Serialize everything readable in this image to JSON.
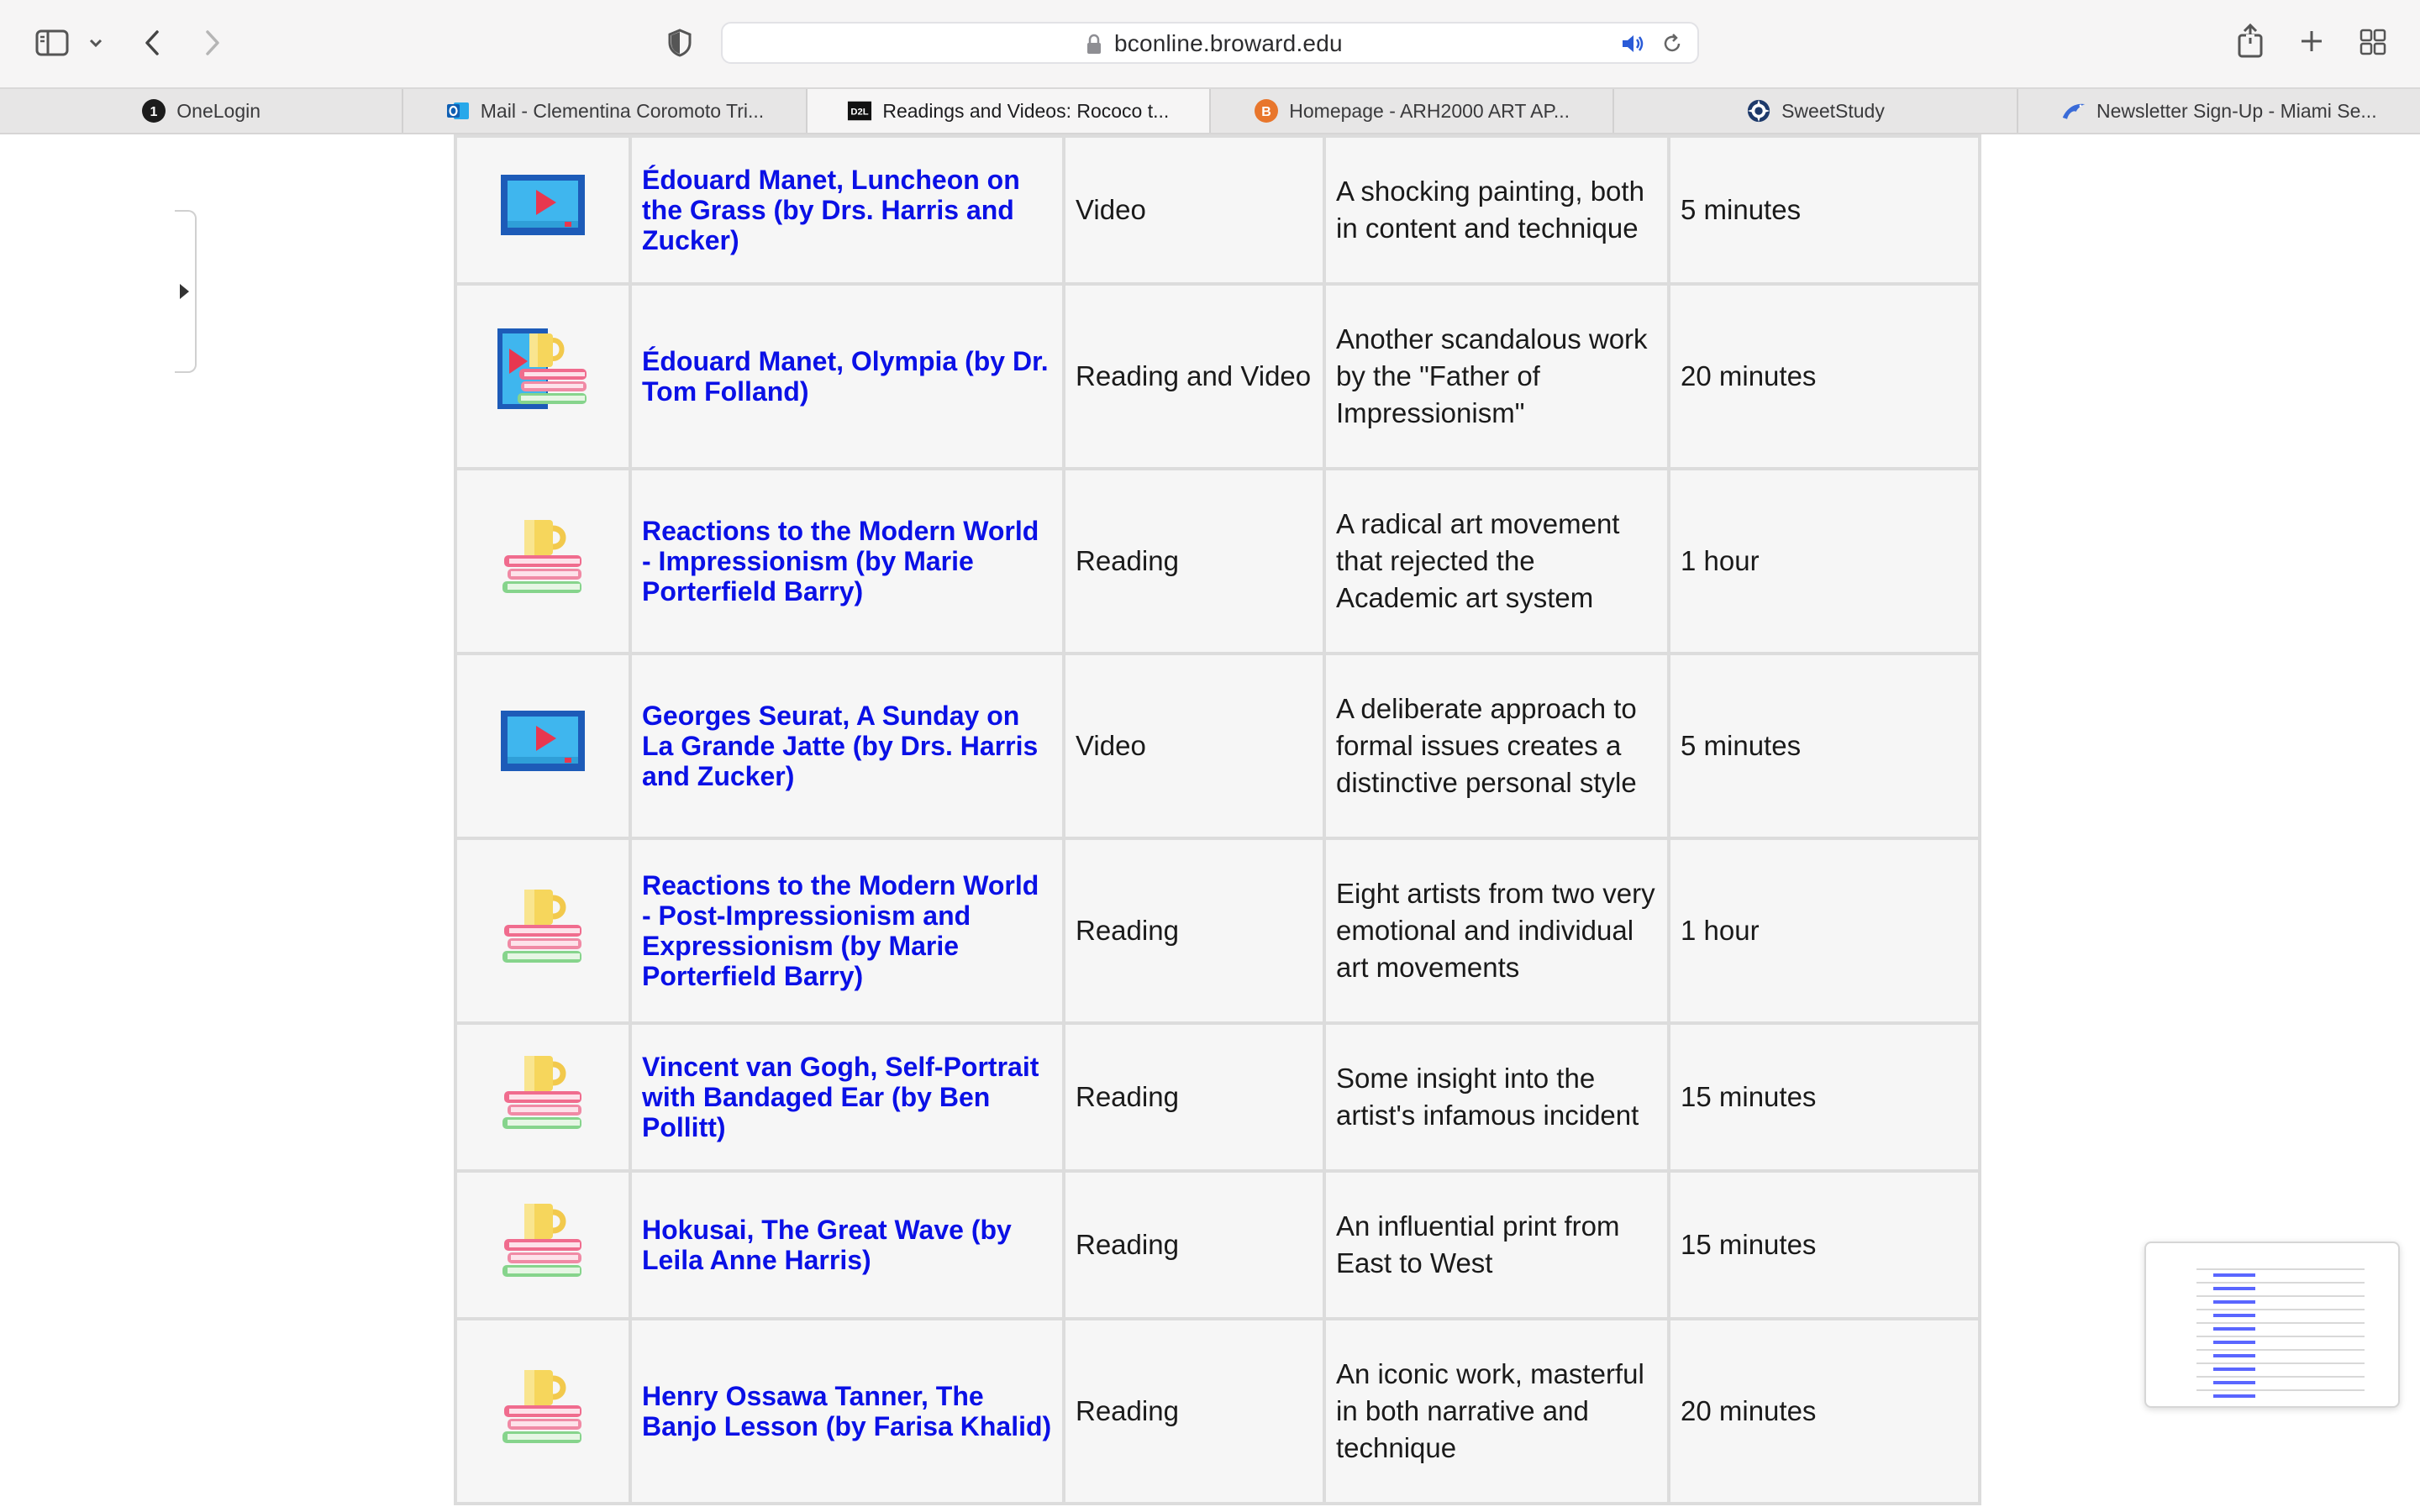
{
  "browser": {
    "url": "bconline.broward.edu"
  },
  "tabs": [
    {
      "label": "OneLogin",
      "icon": "onelogin-icon",
      "active": false
    },
    {
      "label": "Mail - Clementina Coromoto Tri...",
      "icon": "outlook-icon",
      "active": false
    },
    {
      "label": "Readings and Videos: Rococo t...",
      "icon": "d2l-icon",
      "active": true
    },
    {
      "label": "Homepage - ARH2000 ART AP...",
      "icon": "broward-icon",
      "active": false
    },
    {
      "label": "SweetStudy",
      "icon": "sweetstudy-icon",
      "active": false
    },
    {
      "label": "Newsletter Sign-Up - Miami Se...",
      "icon": "seaquarium-icon",
      "active": false
    }
  ],
  "rows": [
    {
      "icon": "video-icon",
      "title": "Édouard Manet, Luncheon on the Grass (by Drs. Harris and Zucker)",
      "type": "Video",
      "description": "A shocking painting, both in content and technique",
      "duration": "5 minutes"
    },
    {
      "icon": "reading-and-video-icon",
      "title": "Édouard Manet, Olympia (by Dr. Tom Folland)",
      "type": "Reading and Video",
      "description": "Another scandalous work by the \"Father of Impressionism\"",
      "duration": "20 minutes"
    },
    {
      "icon": "reading-icon",
      "title": "Reactions to the Modern World - Impressionism (by Marie Porterfield Barry)",
      "type": "Reading",
      "description": "A radical art movement that rejected the Academic art system",
      "duration": "1 hour"
    },
    {
      "icon": "video-icon",
      "title": "Georges Seurat, A Sunday on La Grande Jatte (by Drs. Harris and Zucker)",
      "type": "Video",
      "description": "A deliberate approach to formal issues creates a distinctive personal style",
      "duration": "5 minutes"
    },
    {
      "icon": "reading-icon",
      "title": "Reactions to the Modern World - Post-Impressionism and Expressionism (by Marie Porterfield Barry)",
      "type": "Reading",
      "description": "Eight artists from two very emotional and individual art movements",
      "duration": "1 hour"
    },
    {
      "icon": "reading-icon",
      "title": "Vincent van Gogh, Self-Portrait with Bandaged Ear (by Ben Pollitt)",
      "type": "Reading",
      "description": "Some insight into the artist's infamous incident",
      "duration": "15 minutes"
    },
    {
      "icon": "reading-icon",
      "title": "Hokusai, The Great Wave (by Leila Anne Harris)",
      "type": "Reading",
      "description": "An influential print from East to West",
      "duration": "15 minutes"
    },
    {
      "icon": "reading-icon",
      "title": "Henry Ossawa Tanner, The Banjo Lesson (by Farisa Khalid)",
      "type": "Reading",
      "description": "An iconic work, masterful in both narrative and technique",
      "duration": "20 minutes"
    }
  ],
  "colors": {
    "link": "#0a10e6",
    "cell_bg": "#f6f6f6",
    "cell_border": "#dcdcdc"
  }
}
